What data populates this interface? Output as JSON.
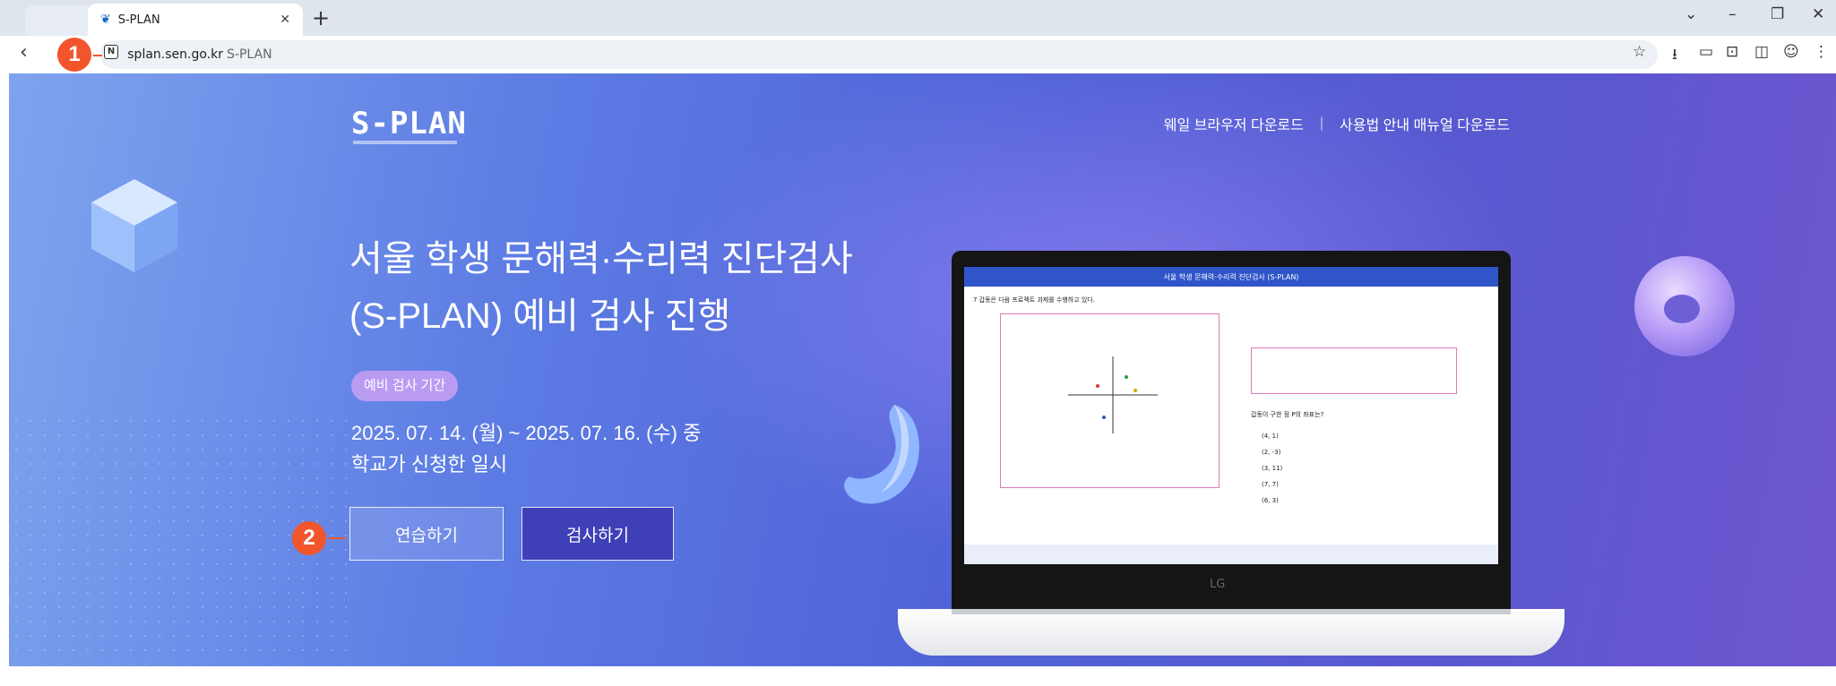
{
  "browser": {
    "tab_title": "S-PLAN",
    "new_tab": "+",
    "url_host": "splan.sen.go.kr",
    "url_site_name": "S-PLAN",
    "controls": {
      "minimize": "–",
      "restore": "❐",
      "close": "✕",
      "tabs_menu": "⌄"
    }
  },
  "header": {
    "logo": "S-PLAN",
    "links": [
      "웨일 브라우저 다운로드",
      "사용법 안내 매뉴얼 다운로드"
    ],
    "separator": "|"
  },
  "hero": {
    "title_line1": "서울 학생 문해력·수리력 진단검사",
    "title_line2": "(S-PLAN) 예비 검사 진행",
    "period_badge": "예비 검사 기간",
    "period_line1": "2025. 07. 14. (월) ~ 2025. 07. 16. (수) 중",
    "period_line2": "학교가 신청한 일시",
    "practice_button": "연습하기",
    "test_button": "검사하기"
  },
  "laptop_screen": {
    "header_title": "서울 학생 문해력·수리력 진단검사 (S-PLAN)",
    "left_question": "7 갑동은 다음 프로젝트 과제를 수행하고 있다.",
    "right_question": "갑동이 구한 점 P의 좌표는?",
    "options": [
      "(4, 1)",
      "(2, -3)",
      "(3, 11)",
      "(7, 7)",
      "(6, 3)"
    ],
    "brand": "LG"
  },
  "annotations": {
    "marker_1": "1",
    "marker_2": "2"
  },
  "colors": {
    "marker": "#f2552c",
    "primary_button": "#3f3fb8",
    "badge": "#b99cf2"
  }
}
